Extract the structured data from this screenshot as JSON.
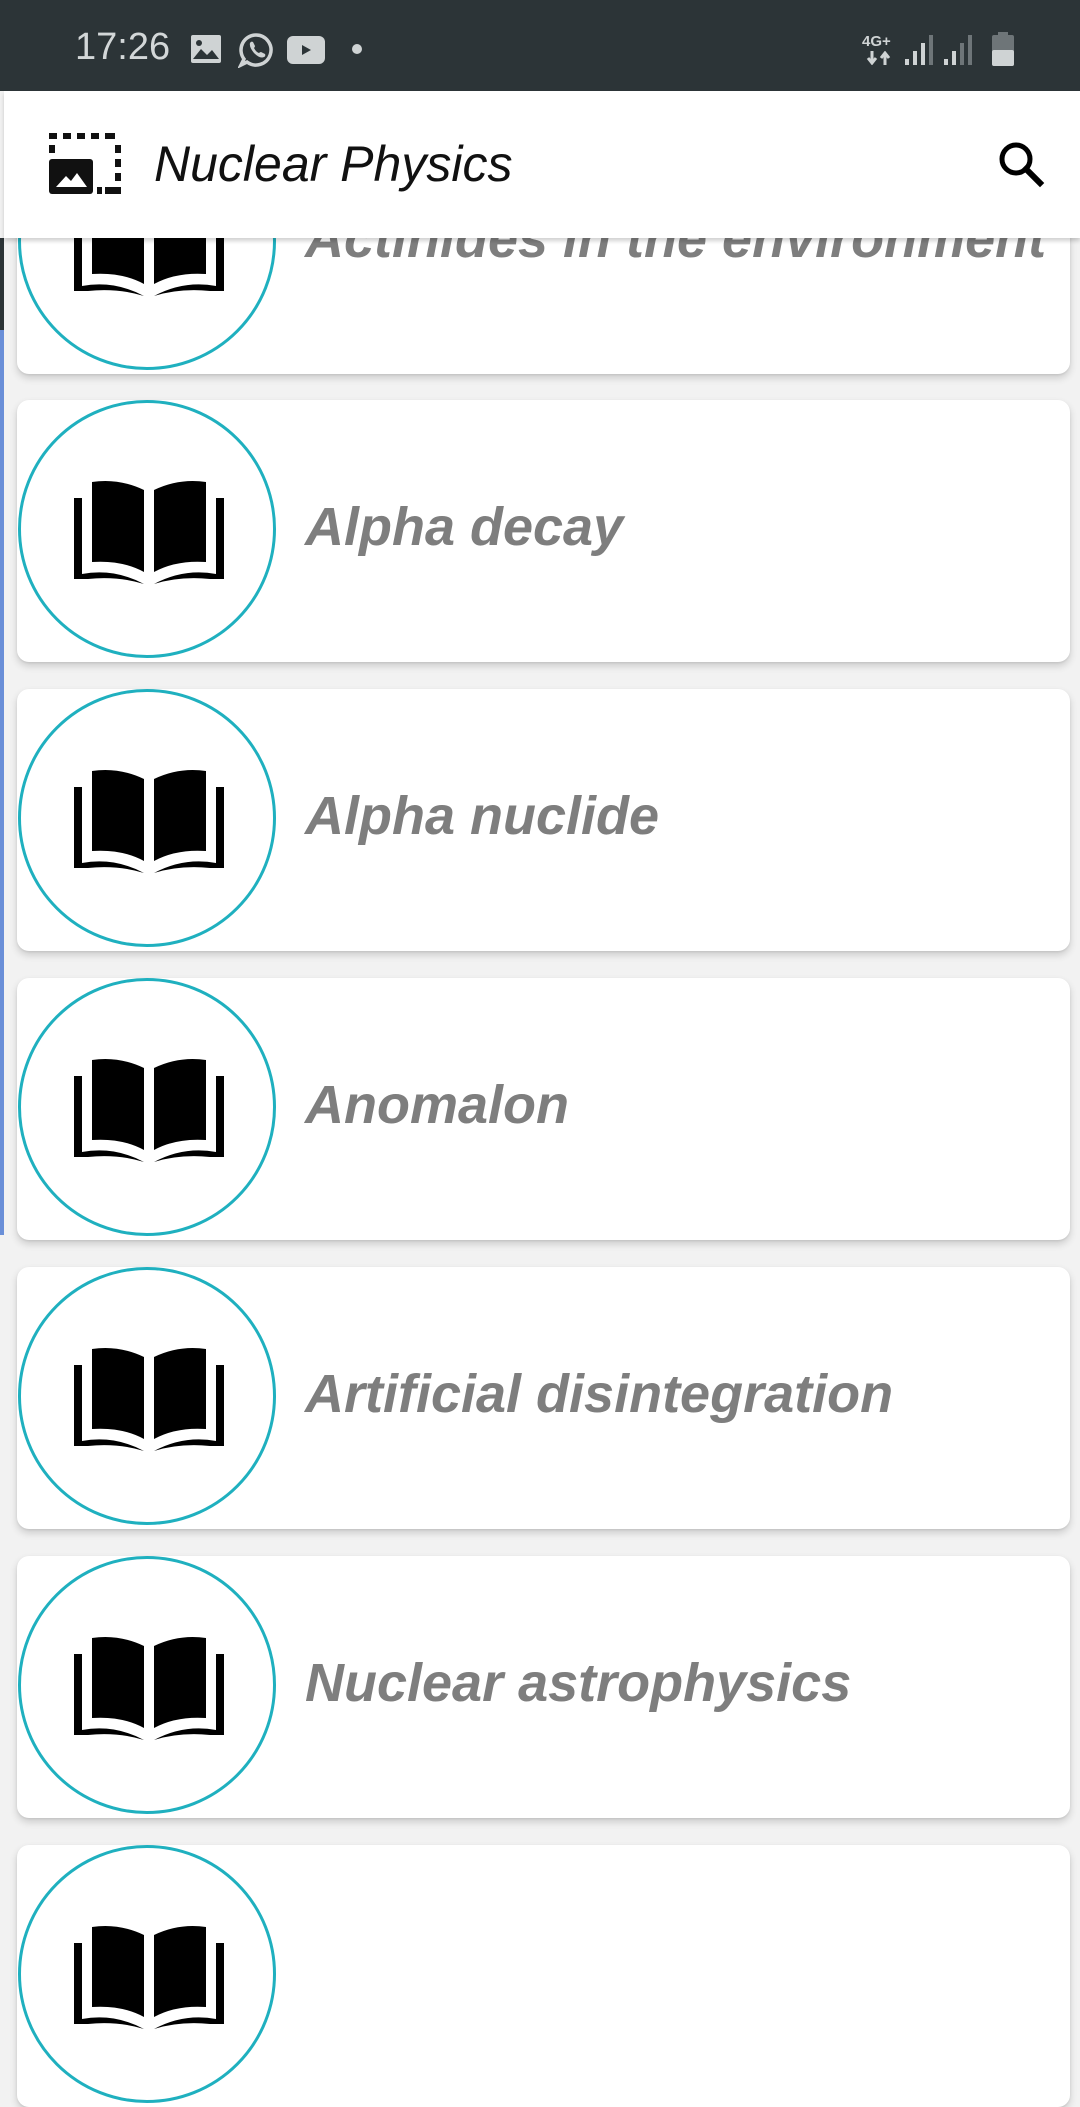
{
  "status_bar": {
    "time": "17:26",
    "notification_icons": [
      "gallery-icon",
      "whatsapp-icon",
      "youtube-icon",
      "more-dot-icon"
    ],
    "network_label": "4G+",
    "system_icons": [
      "network-4g-icon",
      "signal-sim1-icon",
      "signal-sim2-icon",
      "battery-icon"
    ]
  },
  "app_bar": {
    "title": "Nuclear Physics",
    "logo_icon": "photo-frame-icon",
    "search_icon": "search-icon"
  },
  "colors": {
    "status_bar_bg": "#2c3437",
    "circle_accent": "#1fb0bf",
    "item_text": "#7e7e7e",
    "list_bg": "#f2f2f2"
  },
  "list": {
    "items": [
      {
        "label": "Actinides in the environment",
        "icon": "book-icon"
      },
      {
        "label": "Alpha decay",
        "icon": "book-icon"
      },
      {
        "label": "Alpha nuclide",
        "icon": "book-icon"
      },
      {
        "label": "Anomalon",
        "icon": "book-icon"
      },
      {
        "label": "Artificial disintegration",
        "icon": "book-icon"
      },
      {
        "label": "Nuclear astrophysics",
        "icon": "book-icon"
      },
      {
        "label": "",
        "icon": "book-icon"
      }
    ]
  }
}
